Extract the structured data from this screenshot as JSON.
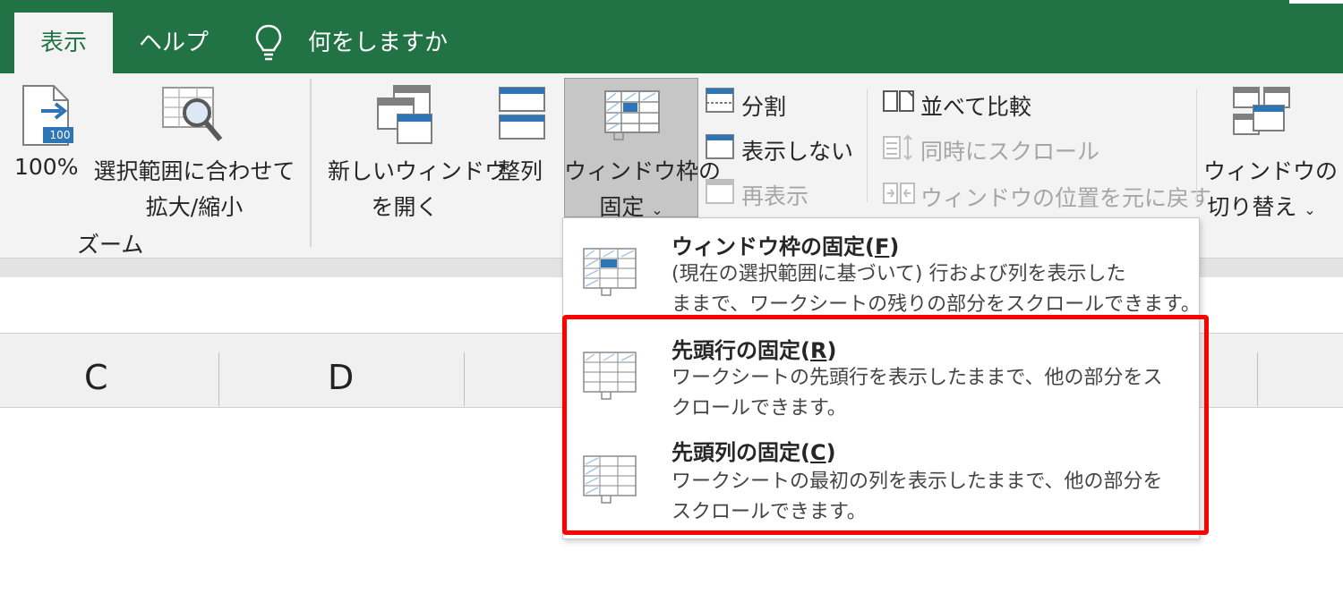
{
  "tabs": {
    "view": "表示",
    "help": "ヘルプ",
    "tell_me": "何をしますか"
  },
  "zoom_group": {
    "zoom100": "100%",
    "zoom_selection_line1": "選択範囲に合わせて",
    "zoom_selection_line2": "拡大/縮小",
    "group_label": "ズーム",
    "icon_badge": "100"
  },
  "window_group": {
    "new_window_line1": "新しいウィンドウ",
    "new_window_line2": "を開く",
    "arrange": "整列",
    "freeze_line1": "ウィンドウ枠の",
    "freeze_line2": "固定",
    "split": "分割",
    "hide": "表示しない",
    "unhide": "再表示",
    "side_by_side": "並べて比較",
    "sync_scroll": "同時にスクロール",
    "reset_position": "ウィンドウの位置を元に戻す",
    "switch_line1": "ウィンドウの",
    "switch_line2": "切り替え"
  },
  "columns": [
    "C",
    "D"
  ],
  "freeze_menu": {
    "panes": {
      "title": "ウィンドウ枠の固定(",
      "key": "F",
      "close": ")",
      "desc1": "(現在の選択範囲に基づいて) 行および列を表示した",
      "desc2": "ままで、ワークシートの残りの部分をスクロールできます。"
    },
    "top_row": {
      "title": "先頭行の固定(",
      "key": "R",
      "close": ")",
      "desc1": "ワークシートの先頭行を表示したままで、他の部分をス",
      "desc2": "クロールできます。"
    },
    "first_column": {
      "title": "先頭列の固定(",
      "key": "C",
      "close": ")",
      "desc1": "ワークシートの最初の列を表示したままで、他の部分を",
      "desc2": "スクロールできます。"
    }
  },
  "colors": {
    "excel_green": "#217346",
    "ribbon_bg": "#f3f3f3",
    "accent_blue": "#2e75b6",
    "highlight_red": "#ff0000"
  }
}
